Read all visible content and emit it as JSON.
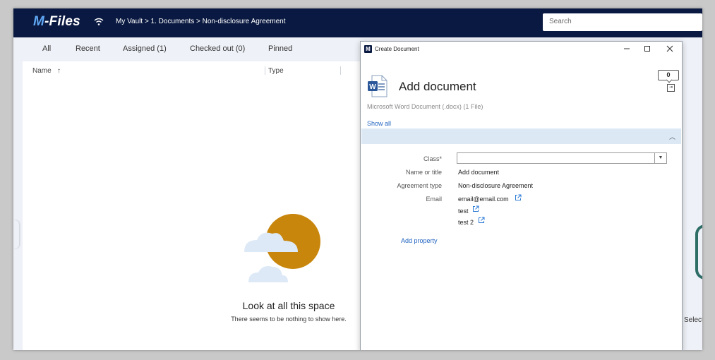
{
  "app": {
    "logo": {
      "prefix": "M",
      "rest": "-Files"
    },
    "breadcrumb": "My Vault > 1. Documents > Non-disclosure Agreement",
    "search": {
      "placeholder": "Search",
      "value": ""
    }
  },
  "tabs": [
    "All",
    "Recent",
    "Assigned (1)",
    "Checked out (0)",
    "Pinned"
  ],
  "list": {
    "columns": {
      "name": "Name",
      "name_sort": "↑",
      "type": "Type"
    },
    "empty_title": "Look at all this space",
    "empty_subtitle": "There seems to be nothing to show here."
  },
  "right_edge_text": "Select",
  "dialog": {
    "window_title": "Create Document",
    "app_icon_letter": "M",
    "doc_icon_letter": "W",
    "heading": "Add document",
    "comment_count": "0",
    "file_info": "Microsoft Word Document (.docx) (1 File)",
    "show_all": "Show all",
    "properties": {
      "class_label": "Class",
      "class_required": "*",
      "class_value": "",
      "name_label": "Name or title",
      "name_value": "Add document",
      "agreement_label": "Agreement type",
      "agreement_value": "Non-disclosure Agreement",
      "email_label": "Email",
      "email_values": [
        "email@email.com",
        "test",
        "test 2"
      ]
    },
    "add_property": "Add property"
  },
  "colors": {
    "topbar": "#0a1941",
    "accent_blue": "#2264c0",
    "section_bar": "#dce9f5",
    "sun": "#c8860d",
    "cloud": "#dde9f6"
  }
}
